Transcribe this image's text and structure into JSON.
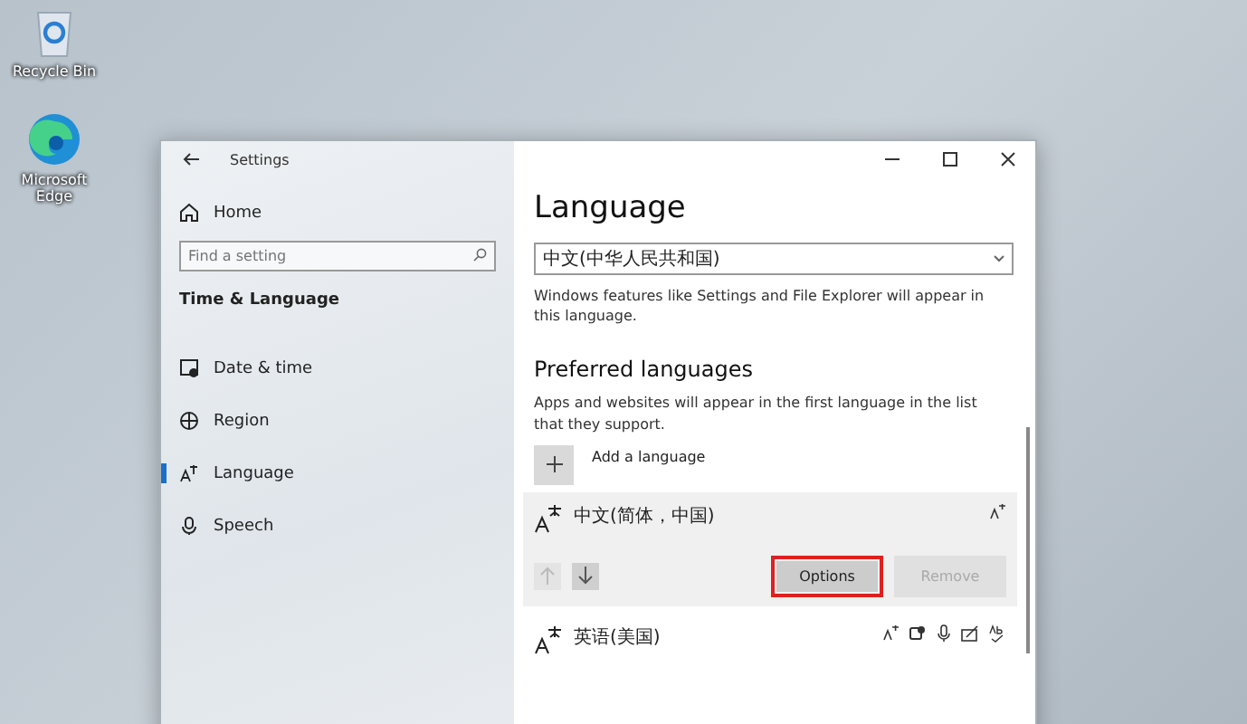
{
  "desktop_icons": [
    {
      "kind": "bin",
      "label": "Recycle Bin"
    },
    {
      "kind": "edge",
      "label": "Microsoft Edge"
    }
  ],
  "window": {
    "title": "Settings"
  },
  "sidebar": {
    "home": "Home",
    "search": {
      "placeholder": "Find a setting"
    },
    "section": "Time & Language",
    "items": [
      {
        "kind": "clock",
        "label": "Date & time",
        "selected": false
      },
      {
        "kind": "globe",
        "label": "Region",
        "selected": false
      },
      {
        "kind": "lang",
        "label": "Language",
        "selected": true
      },
      {
        "kind": "mic",
        "label": "Speech",
        "selected": false
      }
    ]
  },
  "main": {
    "title": "Language",
    "display_language": {
      "value": "中文(中华人民共和国)"
    },
    "display_note": "Windows features like Settings and File Explorer will appear in this language.",
    "preferred_heading": "Preferred languages",
    "preferred_note": "Apps and websites will appear in the first language in the list that they support.",
    "add_language": "Add a language",
    "languages": [
      {
        "name": "中文(简体，中国)",
        "selected": true,
        "features": [
          {
            "kind": "display"
          }
        ],
        "move_buttons": [
          {
            "kind": "up",
            "disabled": true
          },
          {
            "kind": "down",
            "disabled": false
          }
        ],
        "buttons": [
          {
            "label": "Options",
            "disabled": false,
            "highlighted": true
          },
          {
            "label": "Remove",
            "disabled": true,
            "highlighted": false
          }
        ]
      },
      {
        "name": "英语(美国)",
        "selected": false,
        "features": [
          {
            "kind": "display"
          },
          {
            "kind": "speech"
          },
          {
            "kind": "mic"
          },
          {
            "kind": "handwriting"
          },
          {
            "kind": "spelling"
          }
        ]
      }
    ]
  }
}
